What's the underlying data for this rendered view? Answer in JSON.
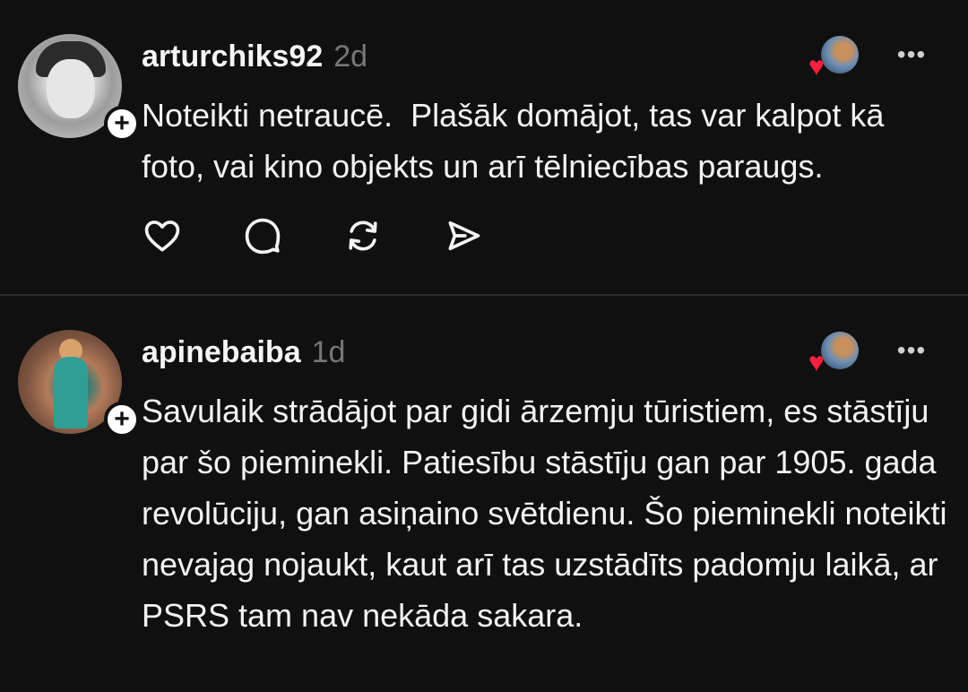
{
  "posts": [
    {
      "username": "arturchiks92",
      "time": "2d",
      "text": "Noteikti netraucē.  Plašāk domājot, tas var kalpot kā foto, vai kino objekts un arī tēlniecības paraugs.",
      "follow_symbol": "+",
      "more_symbol": "•••",
      "liked_heart": "♥",
      "actions": [
        "heart-icon",
        "comment-icon",
        "repost-icon",
        "share-icon"
      ]
    },
    {
      "username": "apinebaiba",
      "time": "1d",
      "text": "Savulaik strādājot par gidi ārzemju tūristiem, es stāstīju par šo pieminekli. Patiesību stāstīju gan par 1905. gada revolūciju, gan asiņaino svētdienu. Šo pieminekli noteikti nevajag nojaukt, kaut arī tas uzstādīts padomju laikā, ar PSRS tam nav nekāda sakara.",
      "follow_symbol": "+",
      "more_symbol": "•••",
      "liked_heart": "♥"
    }
  ],
  "colors": {
    "background": "#101010",
    "text": "#f3f3f3",
    "muted": "#777777",
    "heart": "#ff1f3d"
  }
}
